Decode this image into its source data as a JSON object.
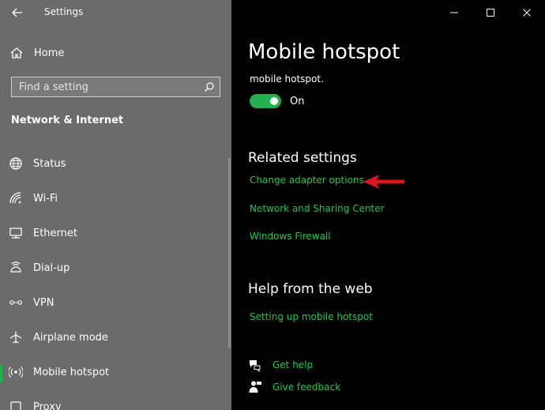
{
  "window": {
    "title": "Settings"
  },
  "sidebar": {
    "home_label": "Home",
    "search_placeholder": "Find a setting",
    "section_heading": "Network & Internet",
    "items": [
      {
        "label": "Status",
        "icon": "globe-icon"
      },
      {
        "label": "Wi-Fi",
        "icon": "wifi-icon"
      },
      {
        "label": "Ethernet",
        "icon": "ethernet-icon"
      },
      {
        "label": "Dial-up",
        "icon": "dialup-icon"
      },
      {
        "label": "VPN",
        "icon": "vpn-icon"
      },
      {
        "label": "Airplane mode",
        "icon": "airplane-icon"
      },
      {
        "label": "Mobile hotspot",
        "icon": "hotspot-icon"
      },
      {
        "label": "Proxy",
        "icon": "proxy-icon"
      }
    ],
    "selected_item": "Mobile hotspot"
  },
  "main": {
    "title": "Mobile hotspot",
    "description_fragment": "mobile hotspot.",
    "toggle": {
      "state": "On",
      "on": true
    },
    "related_heading": "Related settings",
    "related_links": [
      "Change adapter options",
      "Network and Sharing Center",
      "Windows Firewall"
    ],
    "help_heading": "Help from the web",
    "help_links": [
      "Setting up mobile hotspot"
    ],
    "get_help": "Get help",
    "give_feedback": "Give feedback"
  },
  "colors": {
    "accent": "#22b14c",
    "link": "#22c74a",
    "sidebar_bg": "#6b6b6b",
    "content_bg": "#000000",
    "annotation_arrow": "#e0141e"
  }
}
